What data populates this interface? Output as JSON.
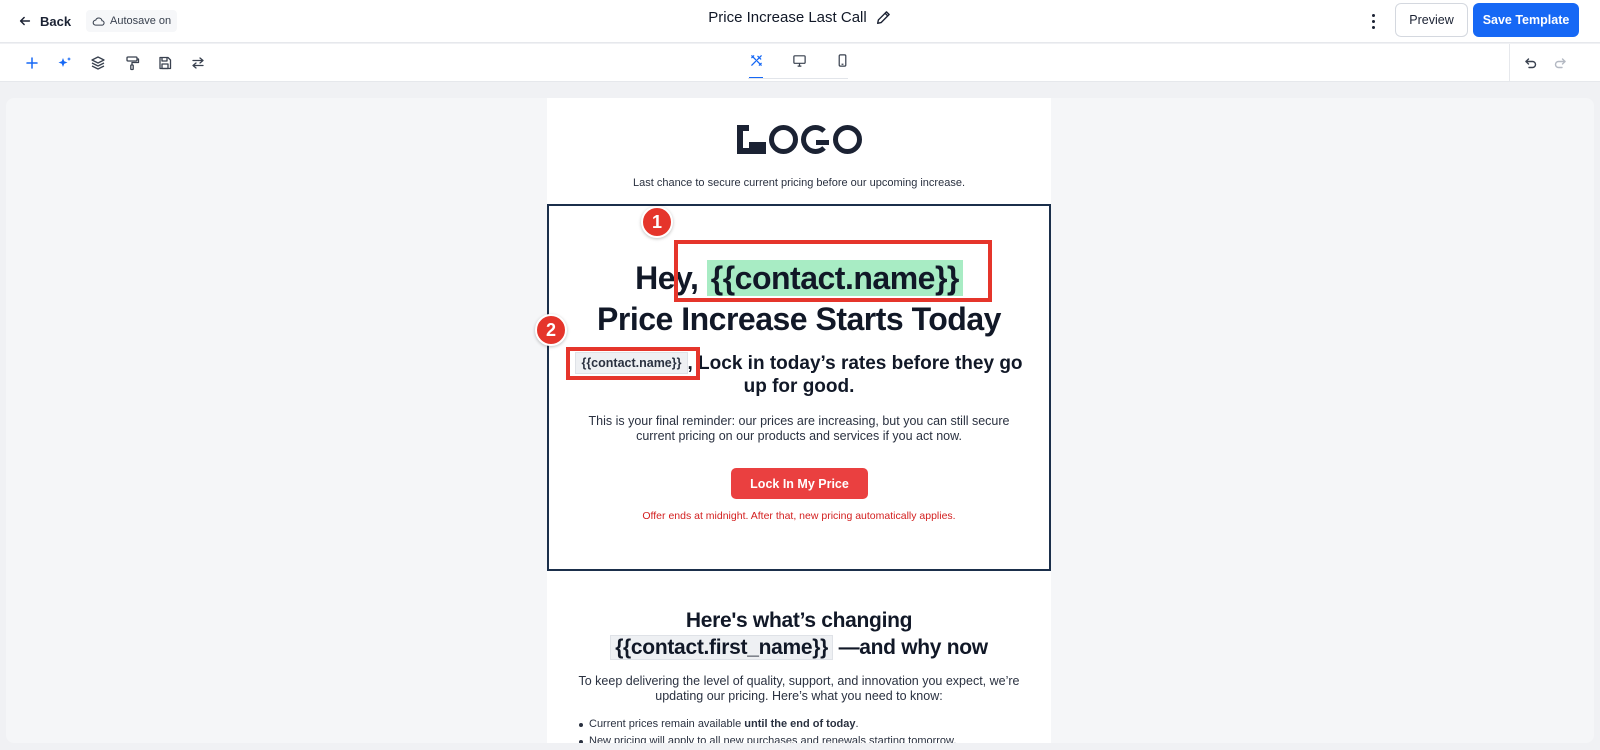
{
  "header": {
    "back_label": "Back",
    "autosave_label": "Autosave on",
    "title": "Price Increase Last Call",
    "preview_label": "Preview",
    "save_label": "Save Template"
  },
  "toolbar": {
    "left_tools": [
      "plus-icon",
      "sparkle-icon",
      "layers-icon",
      "paint-roller-icon",
      "save-icon",
      "swap-icon"
    ],
    "view_tabs": [
      "design-tools-icon",
      "desktop-icon",
      "mobile-icon"
    ],
    "active_view": "design-tools-icon",
    "right_tools": [
      "undo-icon",
      "redo-icon"
    ]
  },
  "email": {
    "preheader": "Last chance to secure current pricing before our upcoming increase.",
    "hero": {
      "headline_prefix": "Hey,",
      "headline_token": "{{contact.name}}",
      "headline_line2": "Price Increase Starts Today",
      "sub_token": "{{contact.name}}",
      "sub_text": ", Lock in today’s rates before they go up for good.",
      "body": "This is your final reminder: our prices are increasing, but you can still secure current pricing on our products and services if you act now.",
      "cta_label": "Lock In My Price",
      "offer_note": "Offer ends at midnight. After that, new pricing automatically applies."
    },
    "section": {
      "heading_line1": "Here's what’s changing",
      "heading_token": "{{contact.first_name}}",
      "heading_suffix": "—and why now",
      "body": "To keep delivering the level of quality, support, and innovation you expect, we’re updating our pricing. Here’s what you need to know:",
      "bullet1_prefix": "Current prices remain available ",
      "bullet1_bold": "until the end of today",
      "bullet1_suffix": ".",
      "bullet2": "New pricing will apply to all new purchases and renewals starting tomorrow."
    }
  },
  "annotations": {
    "marker1": "1",
    "marker2": "2",
    "color": "#e5352b"
  },
  "colors": {
    "accent": "#1668f5",
    "cta": "#ea4040",
    "token_highlight": "#a8ecc4",
    "offer_text": "#d32020"
  }
}
